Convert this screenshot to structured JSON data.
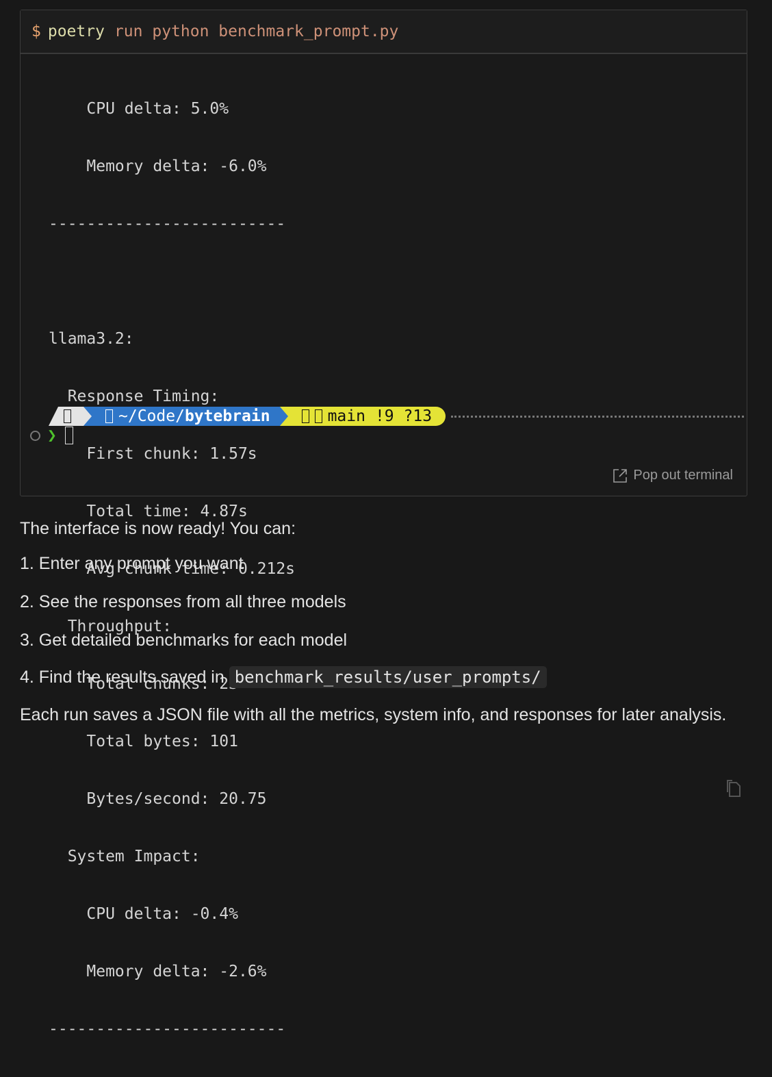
{
  "terminal": {
    "command": {
      "prompt_symbol": "$",
      "program": "poetry",
      "args": "run python benchmark_prompt.py"
    },
    "output_lines": [
      "    CPU delta: 5.0%",
      "    Memory delta: -6.0%",
      "-------------------------",
      "",
      "llama3.2:",
      "  Response Timing:",
      "    First chunk: 1.57s",
      "    Total time: 4.87s",
      "    Avg chunk time: 0.212s",
      "  Throughput:",
      "    Total chunks: 23",
      "    Total bytes: 101",
      "    Bytes/second: 20.75",
      "  System Impact:",
      "    CPU delta: -0.4%",
      "    Memory delta: -2.6%",
      "-------------------------"
    ],
    "shell_prompt": {
      "path_prefix": "~/Code/",
      "path_bold": "bytebrain",
      "branch": "main",
      "git_status": "!9 ?13",
      "chevron": "❯"
    },
    "pop_out_label": "Pop out terminal"
  },
  "message": {
    "intro": "The interface is now ready! You can:",
    "steps": [
      "1. Enter any prompt you want",
      "2. See the responses from all three models",
      "3. Get detailed benchmarks for each model",
      "4. Find the results saved in "
    ],
    "results_path": "benchmark_results/user_prompts/",
    "outro": "Each run saves a JSON file with all the metrics, system info, and responses for later analysis."
  },
  "colors": {
    "path_segment": "#2f76c8",
    "git_segment": "#e4e336",
    "chevron": "#4ec12c"
  }
}
